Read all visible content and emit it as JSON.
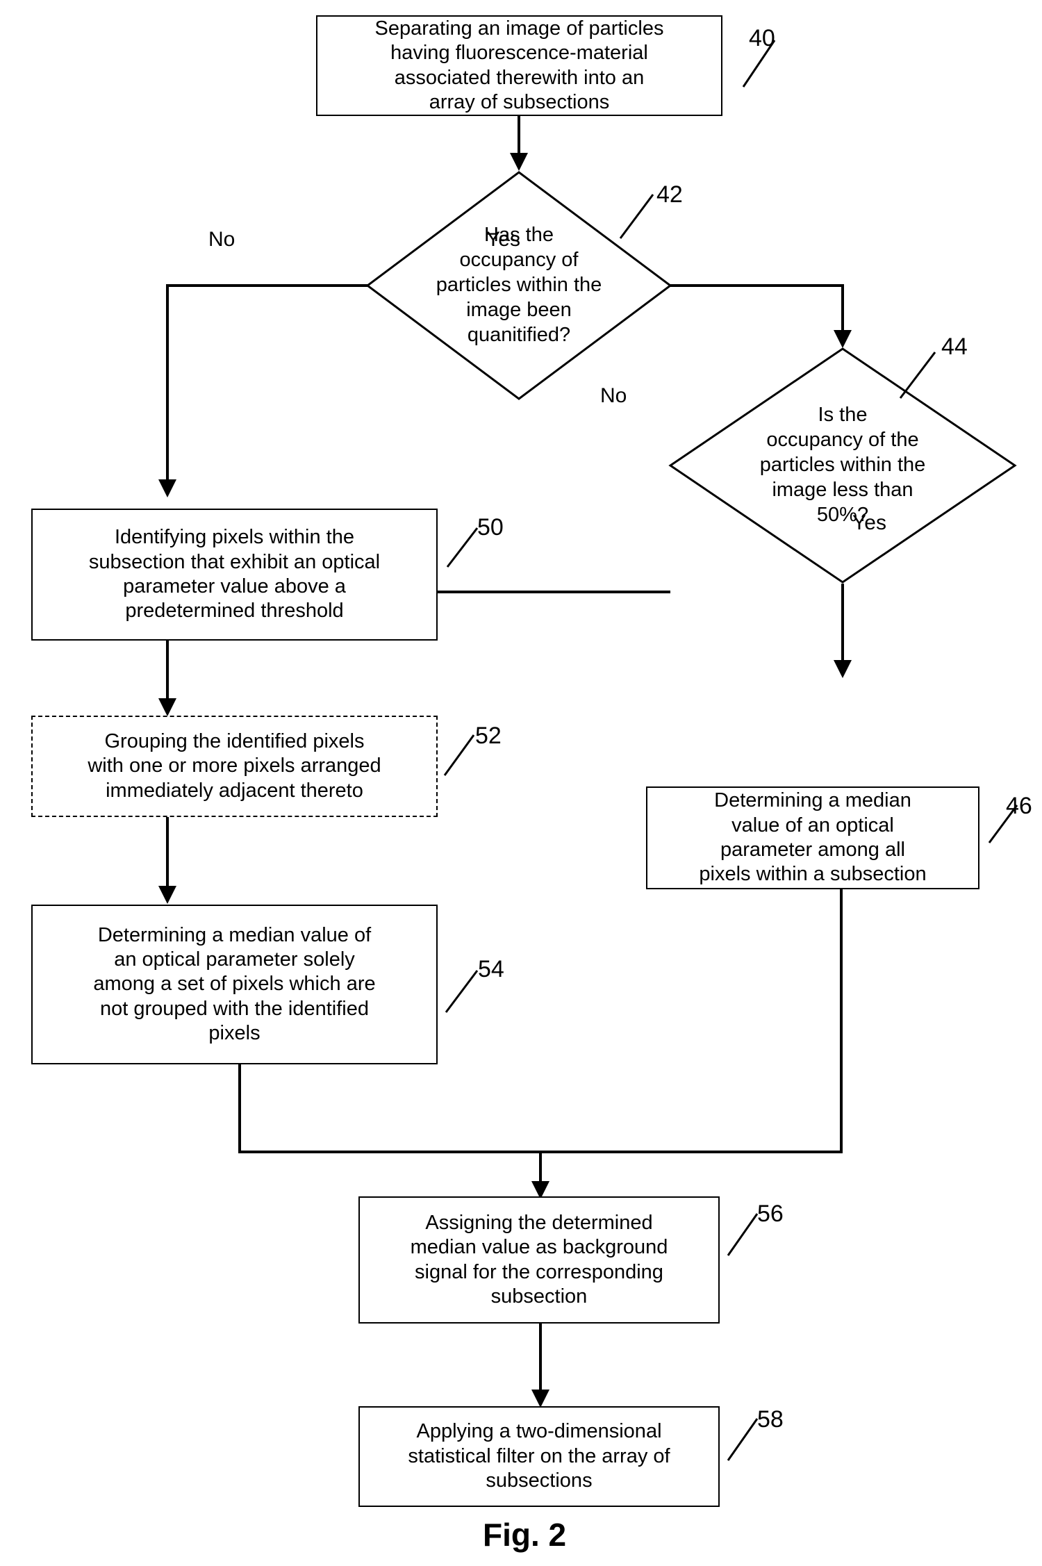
{
  "figure": {
    "caption": "Fig. 2"
  },
  "nodes": {
    "n40": {
      "ref": "40",
      "text": "Separating an image of particles\nhaving fluorescence-material\nassociated therewith into an\narray of subsections"
    },
    "n42": {
      "ref": "42",
      "text": "Has the\noccupancy of\nparticles within the\nimage been\nquanitified?"
    },
    "n44": {
      "ref": "44",
      "text": "Is the\noccupancy of the\nparticles within the\nimage less than\n50%?"
    },
    "n46": {
      "ref": "46",
      "text": "Determining a median\nvalue of an optical\nparameter among all\npixels within a subsection"
    },
    "n50": {
      "ref": "50",
      "text": "Identifying pixels within the\nsubsection that exhibit an optical\nparameter value above a\npredetermined threshold"
    },
    "n52": {
      "ref": "52",
      "text": "Grouping the identified pixels\nwith one or more pixels arranged\nimmediately adjacent thereto"
    },
    "n54": {
      "ref": "54",
      "text": "Determining a median value of\nan optical parameter solely\namong a set of pixels which are\nnot grouped with the identified\npixels"
    },
    "n56": {
      "ref": "56",
      "text": "Assigning the determined\nmedian value as background\nsignal for the corresponding\nsubsection"
    },
    "n58": {
      "ref": "58",
      "text": "Applying a two-dimensional\nstatistical filter on the array of\nsubsections"
    }
  },
  "edge_labels": {
    "d42_no": "No",
    "d42_yes": "Yes",
    "d44_no": "No",
    "d44_yes": "Yes"
  },
  "colors": {
    "stroke": "#000000",
    "background": "#ffffff"
  }
}
